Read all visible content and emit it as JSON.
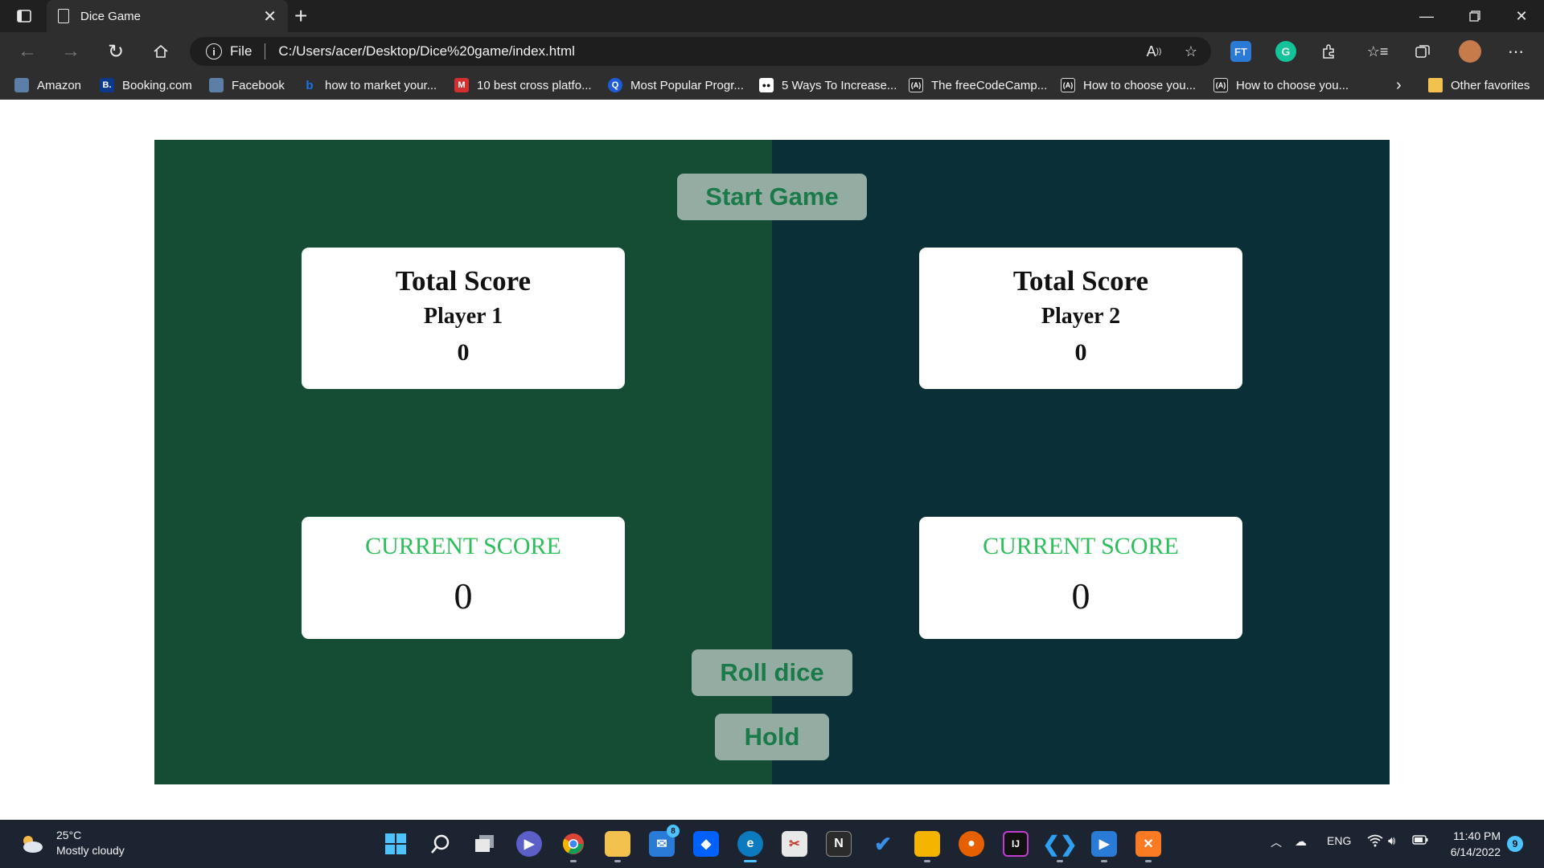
{
  "browser": {
    "tab_title": "Dice Game",
    "address_label": "File",
    "url": "C:/Users/acer/Desktop/Dice%20game/index.html",
    "extension_text": "FT",
    "bookmarks": [
      {
        "label": "Amazon",
        "color": "#5b7fa6",
        "glyph": ""
      },
      {
        "label": "Booking.com",
        "color": "#0b3a8c",
        "glyph": "B."
      },
      {
        "label": "Facebook",
        "color": "#5b7fa6",
        "glyph": ""
      },
      {
        "label": "how to market your...",
        "color": "#1a73e8",
        "glyph": "b"
      },
      {
        "label": "10 best cross platfo...",
        "color": "#d32f2f",
        "glyph": "M"
      },
      {
        "label": "Most Popular Progr...",
        "color": "#1e5bd8",
        "glyph": "Q"
      },
      {
        "label": "5 Ways To Increase...",
        "color": "#111111",
        "glyph": "●●"
      },
      {
        "label": "The freeCodeCamp...",
        "color": "#222222",
        "glyph": "(A)"
      },
      {
        "label": "How to choose you...",
        "color": "#222222",
        "glyph": "(A)"
      },
      {
        "label": "How to choose you...",
        "color": "#222222",
        "glyph": "(A)"
      }
    ],
    "other_favorites": "Other favorites"
  },
  "game": {
    "start_label": "Start Game",
    "roll_label": "Roll dice",
    "hold_label": "Hold",
    "player1": {
      "total_label": "Total Score",
      "name": "Player 1",
      "total": "0",
      "current_label": "CURRENT SCORE",
      "current": "0"
    },
    "player2": {
      "total_label": "Total Score",
      "name": "Player 2",
      "total": "0",
      "current_label": "CURRENT SCORE",
      "current": "0"
    },
    "colors": {
      "left_bg": "#144d33",
      "right_bg": "#0b2f37",
      "button_bg": "#95aca3",
      "button_text": "#1a7a4a",
      "current_label": "#2bbf5a"
    }
  },
  "taskbar": {
    "temperature": "25°C",
    "weather": "Mostly cloudy",
    "language": "ENG",
    "time": "11:40 PM",
    "date": "6/14/2022",
    "notification_count": "9",
    "mail_badge": "8"
  }
}
